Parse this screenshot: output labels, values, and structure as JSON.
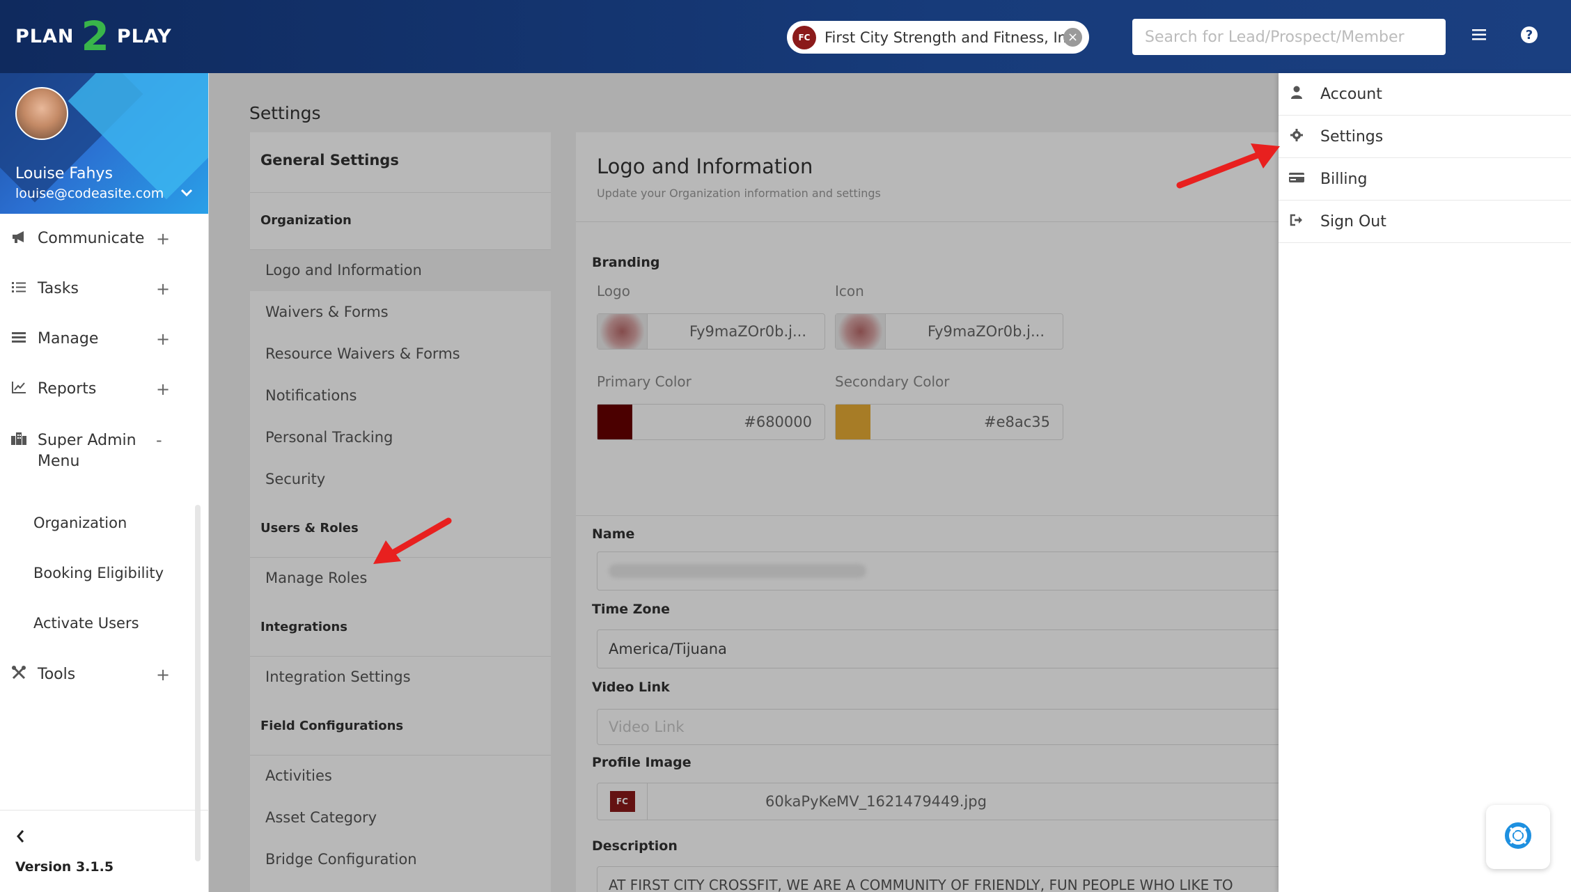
{
  "app": {
    "logo_left": "PLAN",
    "logo_mid": "2",
    "logo_right": "PLAY"
  },
  "header": {
    "org_badge": "FC",
    "org_name": "First City Strength and Fitness, Inc.",
    "clear_icon": "close-icon",
    "search_placeholder": "Search for Lead/Prospect/Member",
    "menu_icon": "hamburger-icon",
    "help_icon": "?"
  },
  "user": {
    "name": "Louise Fahys",
    "email": "louise@codeasite.com"
  },
  "sidebar": {
    "items": [
      {
        "label": "Communicate",
        "icon": "megaphone-icon",
        "toggle": "+"
      },
      {
        "label": "Tasks",
        "icon": "list-icon",
        "toggle": "+"
      },
      {
        "label": "Manage",
        "icon": "bars-icon",
        "toggle": "+"
      },
      {
        "label": "Reports",
        "icon": "chart-icon",
        "toggle": "+"
      },
      {
        "label": "Super Admin",
        "label2": "Menu",
        "icon": "building-icon",
        "toggle": "-"
      },
      {
        "label": "Tools",
        "icon": "tools-icon",
        "toggle": "+"
      }
    ],
    "sub_items": [
      "Organization",
      "Booking Eligibility",
      "Activate Users"
    ],
    "version": "Version 3.1.5"
  },
  "page": {
    "title": "Settings"
  },
  "settings_nav": {
    "title": "General Settings",
    "sections": [
      {
        "name": "Organization",
        "items": [
          "Logo and Information",
          "Waivers & Forms",
          "Resource Waivers & Forms",
          "Notifications",
          "Personal Tracking",
          "Security"
        ]
      },
      {
        "name": "Users & Roles",
        "items": [
          "Manage Roles"
        ]
      },
      {
        "name": "Integrations",
        "items": [
          "Integration Settings"
        ]
      },
      {
        "name": "Field Configurations",
        "items": [
          "Activities",
          "Asset Category",
          "Bridge Configuration"
        ]
      }
    ]
  },
  "content": {
    "title": "Logo and Information",
    "subtitle": "Update your Organization information and settings",
    "branding_label": "Branding",
    "logo_label": "Logo",
    "logo_file": "Fy9maZOr0b.j...",
    "icon_label": "Icon",
    "icon_file": "Fy9maZOr0b.j...",
    "primary_label": "Primary Color",
    "primary_value": "#680000",
    "secondary_label": "Secondary Color",
    "secondary_value": "#e8ac35",
    "name_label": "Name",
    "timezone_label": "Time Zone",
    "timezone_value": "America/Tijuana",
    "video_label": "Video Link",
    "video_placeholder": "Video Link",
    "profile_label": "Profile Image",
    "profile_badge": "FC",
    "profile_file": "60kaPyKeMV_1621479449.jpg",
    "description_label": "Description",
    "description_value": "AT FIRST CITY CROSSFIT, WE ARE A COMMUNITY OF FRIENDLY, FUN PEOPLE WHO LIKE TO"
  },
  "dropdown": {
    "items": [
      {
        "label": "Account",
        "icon": "user-icon"
      },
      {
        "label": "Settings",
        "icon": "gear-icon"
      },
      {
        "label": "Billing",
        "icon": "card-icon"
      },
      {
        "label": "Sign Out",
        "icon": "sign-out-icon"
      }
    ]
  },
  "colors": {
    "header": "#173b7a",
    "brand_green": "#39b54a",
    "primary": "#680000",
    "secondary": "#e8ac35",
    "arrow": "#e8201f"
  }
}
